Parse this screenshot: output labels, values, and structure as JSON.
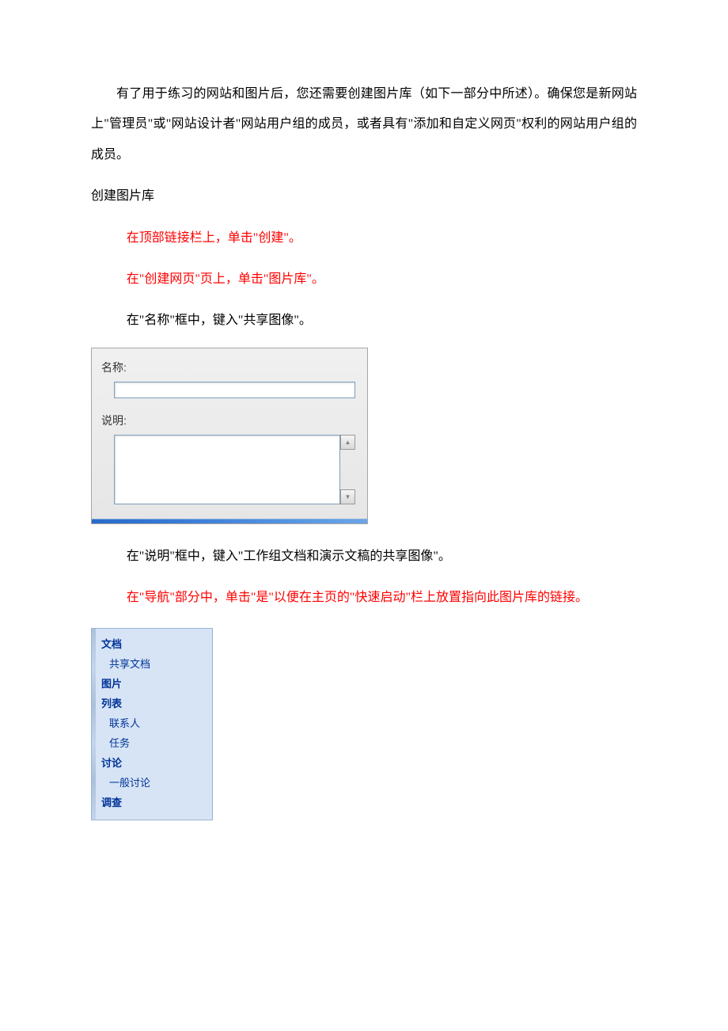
{
  "paragraphs": {
    "intro": "有了用于练习的网站和图片后，您还需要创建图片库（如下一部分中所述）。确保您是新网站上\"管理员\"或\"网站设计者\"网站用户组的成员，或者具有\"添加和自定义网页\"权利的网站用户组的成员。",
    "heading": "创建图片库",
    "step1": "在顶部链接栏上，单击\"创建\"。",
    "step2": "在\"创建网页\"页上，单击\"图片库\"。",
    "step3": "在\"名称\"框中，键入\"共享图像\"。",
    "step4": "在\"说明\"框中，键入\"工作组文档和演示文稿的共享图像\"。",
    "step5": "在\"导航\"部分中，单击\"是\"以便在主页的\"快速启动\"栏上放置指向此图片库的链接。"
  },
  "form": {
    "label_name": "名称:",
    "label_desc": "说明:",
    "name_value": "",
    "desc_value": ""
  },
  "nav": {
    "cat1": "文档",
    "item1": "共享文档",
    "cat2": "图片",
    "cat3": "列表",
    "item2": "联系人",
    "item3": "任务",
    "cat4": "讨论",
    "item4": "一般讨论",
    "cat5": "调查"
  }
}
